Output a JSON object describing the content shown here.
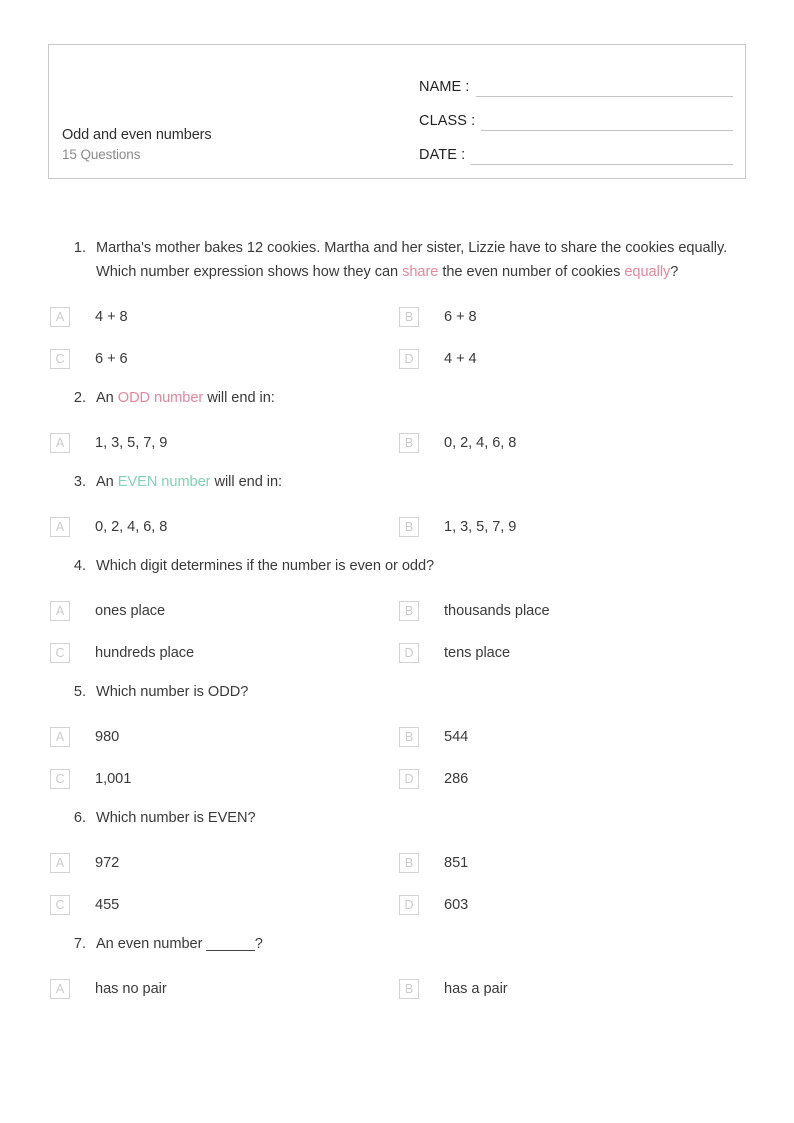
{
  "header": {
    "title": "Odd and even numbers",
    "subtitle": "15 Questions",
    "fields": [
      {
        "label": "NAME :"
      },
      {
        "label": "CLASS :"
      },
      {
        "label": "DATE  :"
      }
    ]
  },
  "colors": {
    "pink": "#e8859b",
    "green": "#7fd4b4",
    "text": "#3a3a3a",
    "muted": "#8a8a8a",
    "box_border": "#c9c9c9",
    "letter_border": "#d3d3d3",
    "letter_text": "#cbcbcb"
  },
  "questions": [
    {
      "number": "1.",
      "parts": [
        {
          "t": "Martha's mother bakes 12 cookies. Martha and her sister, Lizzie have to share the cookies equally. Which number expression shows how they can ",
          "c": ""
        },
        {
          "t": "share",
          "c": "pink"
        },
        {
          "t": " the even number of cookies ",
          "c": ""
        },
        {
          "t": "equally",
          "c": "pink"
        },
        {
          "t": "?",
          "c": ""
        }
      ],
      "options": [
        {
          "letter": "A",
          "text": "4 + 8"
        },
        {
          "letter": "B",
          "text": "6 + 8"
        },
        {
          "letter": "C",
          "text": "6 + 6"
        },
        {
          "letter": "D",
          "text": "4 + 4"
        }
      ]
    },
    {
      "number": "2.",
      "parts": [
        {
          "t": "An ",
          "c": ""
        },
        {
          "t": "ODD number",
          "c": "pink"
        },
        {
          "t": " will end in:",
          "c": ""
        }
      ],
      "options": [
        {
          "letter": "A",
          "text": "1, 3, 5, 7, 9"
        },
        {
          "letter": "B",
          "text": "0, 2, 4, 6, 8"
        }
      ]
    },
    {
      "number": "3.",
      "parts": [
        {
          "t": "An ",
          "c": ""
        },
        {
          "t": "EVEN number",
          "c": "green"
        },
        {
          "t": " will end in:",
          "c": ""
        }
      ],
      "options": [
        {
          "letter": "A",
          "text": "0, 2, 4, 6, 8"
        },
        {
          "letter": "B",
          "text": "1, 3, 5, 7, 9"
        }
      ]
    },
    {
      "number": "4.",
      "parts": [
        {
          "t": "Which digit determines if the number is even or odd?",
          "c": ""
        }
      ],
      "options": [
        {
          "letter": "A",
          "text": "ones place"
        },
        {
          "letter": "B",
          "text": "thousands place"
        },
        {
          "letter": "C",
          "text": "hundreds place"
        },
        {
          "letter": "D",
          "text": "tens place"
        }
      ]
    },
    {
      "number": "5.",
      "parts": [
        {
          "t": "Which number is ODD?",
          "c": ""
        }
      ],
      "options": [
        {
          "letter": "A",
          "text": "980"
        },
        {
          "letter": "B",
          "text": "544"
        },
        {
          "letter": "C",
          "text": "1,001"
        },
        {
          "letter": "D",
          "text": "286"
        }
      ]
    },
    {
      "number": "6.",
      "parts": [
        {
          "t": "Which number is EVEN?",
          "c": ""
        }
      ],
      "options": [
        {
          "letter": "A",
          "text": "972"
        },
        {
          "letter": "B",
          "text": "851"
        },
        {
          "letter": "C",
          "text": "455"
        },
        {
          "letter": "D",
          "text": "603"
        }
      ]
    },
    {
      "number": "7.",
      "parts": [
        {
          "t": "An even number ______?",
          "c": ""
        }
      ],
      "options": [
        {
          "letter": "A",
          "text": "has no pair"
        },
        {
          "letter": "B",
          "text": "has a pair"
        }
      ]
    }
  ]
}
